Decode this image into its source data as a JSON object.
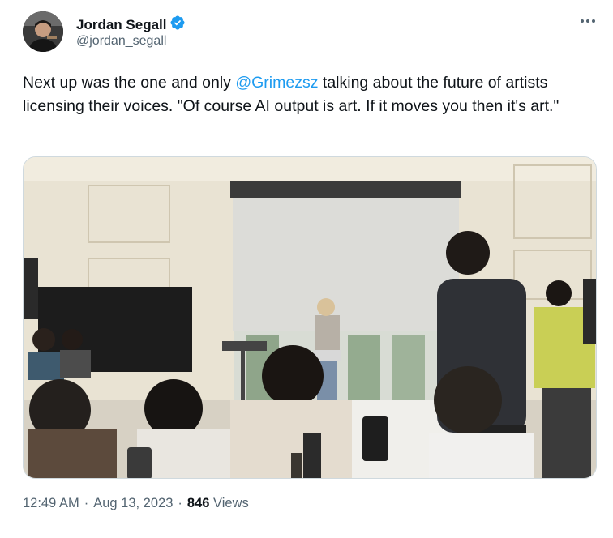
{
  "author": {
    "name": "Jordan Segall",
    "handle": "@jordan_segall",
    "verified": true
  },
  "tweet": {
    "text_before": "Next up was the one and only ",
    "mention": "@Grimezsz",
    "text_after": " talking about the future of artists licensing their voices. \"Of course AI output is art. If it moves you then it's art.\""
  },
  "meta": {
    "time": "12:49 AM",
    "sep1": "·",
    "date": "Aug 13, 2023",
    "sep2": "·",
    "views_count": "846",
    "views_label": "Views"
  },
  "colors": {
    "accent": "#1d9bf0",
    "text": "#0f1419",
    "muted": "#536471"
  },
  "icons": {
    "verified": "verified-badge-icon",
    "more": "more-options-icon"
  }
}
